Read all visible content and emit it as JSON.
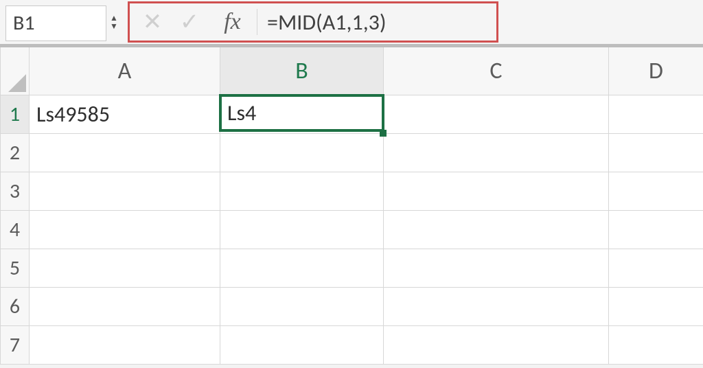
{
  "name_box": {
    "value": "B1"
  },
  "formula_bar": {
    "cancel_glyph": "✕",
    "enter_glyph": "✓",
    "fx_label": "fx",
    "formula": "=MID(A1,1,3)"
  },
  "columns": [
    "A",
    "B",
    "C",
    "D"
  ],
  "active_column_index": 1,
  "rows": [
    1,
    2,
    3,
    4,
    5,
    6,
    7
  ],
  "active_row_index": 0,
  "cells": {
    "A1": "Ls49585",
    "B1": "Ls4"
  },
  "selected_cell": "B1"
}
